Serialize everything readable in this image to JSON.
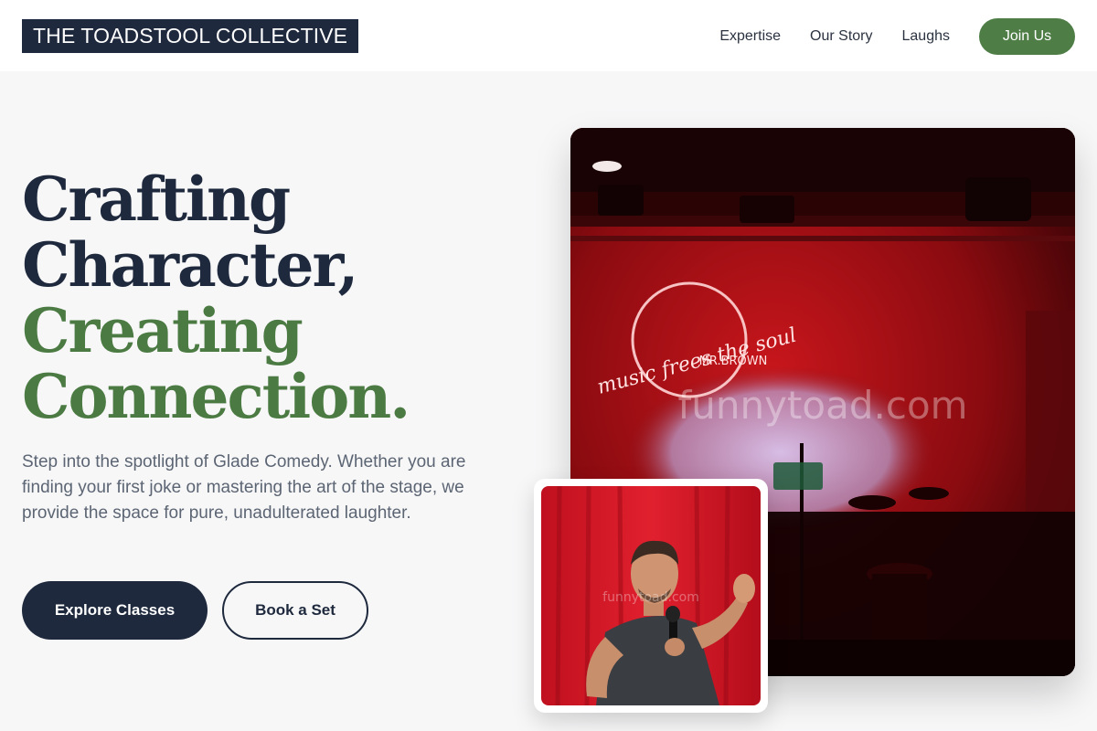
{
  "header": {
    "logo": "THE TOADSTOOL COLLECTIVE",
    "nav": [
      "Expertise",
      "Our Story",
      "Laughs"
    ],
    "cta": "Join Us"
  },
  "hero": {
    "headline": {
      "line1": "Crafting",
      "line2": "Character,",
      "line3": "Creating",
      "line4": "Connection."
    },
    "lead": "Step into the spotlight of Glade Comedy. Whether you are finding your first joke or mastering the art of the stage, we provide the space for pure, unadulterated laughter.",
    "primary_button": "Explore Classes",
    "secondary_button": "Book a Set"
  },
  "images": {
    "stage_watermark": "funnytoad.com",
    "neon_sign_script": "music frees the soul",
    "neon_sign_name": "MR.BROWN",
    "performer_watermark": "funnytoad.com"
  },
  "colors": {
    "navy": "#1e293d",
    "green": "#4b7a42",
    "button_green": "#4e7d46",
    "background": "#f7f7f8"
  }
}
